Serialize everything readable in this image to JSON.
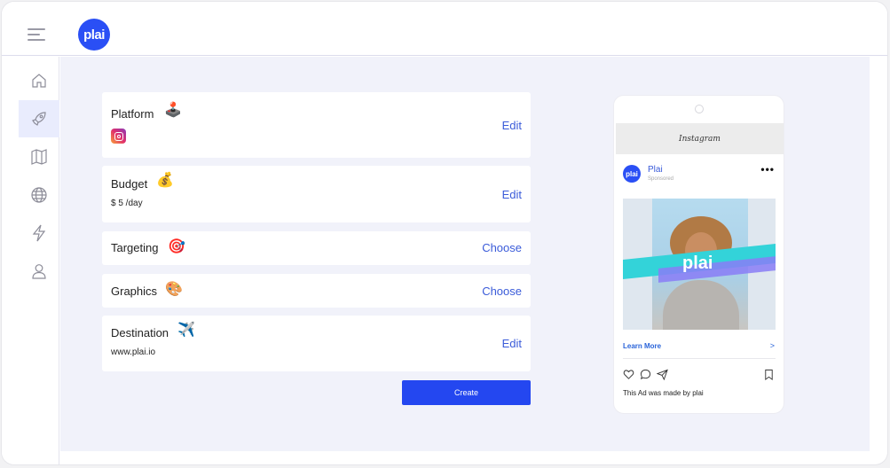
{
  "topbar": {
    "logo_text": "plai",
    "menu_icon": "hamburger-icon"
  },
  "sidebar": {
    "items": [
      {
        "icon": "home-icon",
        "active": false
      },
      {
        "icon": "rocket-icon",
        "active": true
      },
      {
        "icon": "map-icon",
        "active": false
      },
      {
        "icon": "globe-icon",
        "active": false
      },
      {
        "icon": "lightning-icon",
        "active": false
      },
      {
        "icon": "user-icon",
        "active": false
      }
    ]
  },
  "cards": {
    "platform": {
      "title": "Platform",
      "action": "Edit",
      "emoji": "🕹️",
      "sub_icon": "instagram-icon"
    },
    "budget": {
      "title": "Budget",
      "action": "Edit",
      "emoji": "💰",
      "value": "$ 5 /day"
    },
    "targeting": {
      "title": "Targeting",
      "action": "Choose",
      "emoji": "🎯"
    },
    "graphics": {
      "title": "Graphics",
      "action": "Choose",
      "emoji": "🎨"
    },
    "destination": {
      "title": "Destination",
      "action": "Edit",
      "emoji": "✈️",
      "value": "www.plai.io"
    }
  },
  "create_button": "Create",
  "preview": {
    "app_name": "Instagram",
    "account_avatar": "plai",
    "account_name": "Plai",
    "sponsored": "Sponsored",
    "menu": "•••",
    "image_brand": "plai",
    "cta": "Learn More",
    "cta_chevron": ">",
    "caption": "This Ad was made by plai"
  },
  "colors": {
    "accent": "#2447f0",
    "link": "#3a5bd9",
    "background": "#f1f2fa"
  }
}
